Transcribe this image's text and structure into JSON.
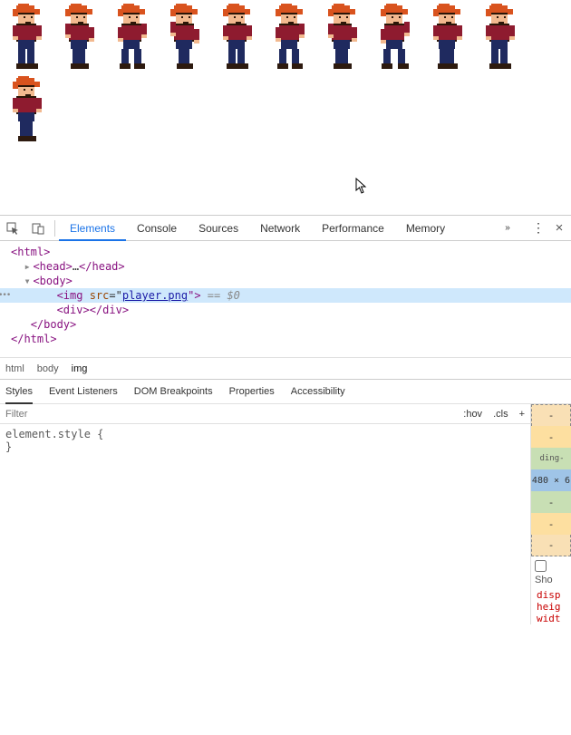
{
  "viewport": {
    "sprite_count": 11
  },
  "devtools": {
    "tabs": [
      "Elements",
      "Console",
      "Sources",
      "Network",
      "Performance",
      "Memory"
    ],
    "active_tab": "Elements",
    "overflow_glyph": "»",
    "more_glyph": "⋮",
    "close_glyph": "×"
  },
  "dom": {
    "l0": "<html>",
    "l1_arrow": "▸",
    "l1a": "<head>",
    "l1b": "…",
    "l1c": "</head>",
    "l2_arrow": "▾",
    "l2": "<body>",
    "l3a": "<img ",
    "l3b": "src",
    "l3c": "=\"",
    "l3d": "player.png",
    "l3e": "\">",
    "l3f": " == $0",
    "l4": "<div></div>",
    "l5": "</body>",
    "l6": "</html>"
  },
  "crumbs": {
    "c1": "html",
    "c2": "body",
    "c3": "img"
  },
  "subtabs": {
    "t1": "Styles",
    "t2": "Event Listeners",
    "t3": "DOM Breakpoints",
    "t4": "Properties",
    "t5": "Accessibility"
  },
  "filterbar": {
    "placeholder": "Filter",
    "hov": ":hov",
    "cls": ".cls",
    "plus": "+"
  },
  "rules": {
    "l1": "element.style {",
    "l2": "}"
  },
  "boxmodel": {
    "dash": "-",
    "pad_label": "ding-",
    "core": "480 × 6"
  },
  "showarea": {
    "label": "Sho"
  },
  "proplist": {
    "p1": "disp",
    "p2": "heig",
    "p3": "widt"
  }
}
